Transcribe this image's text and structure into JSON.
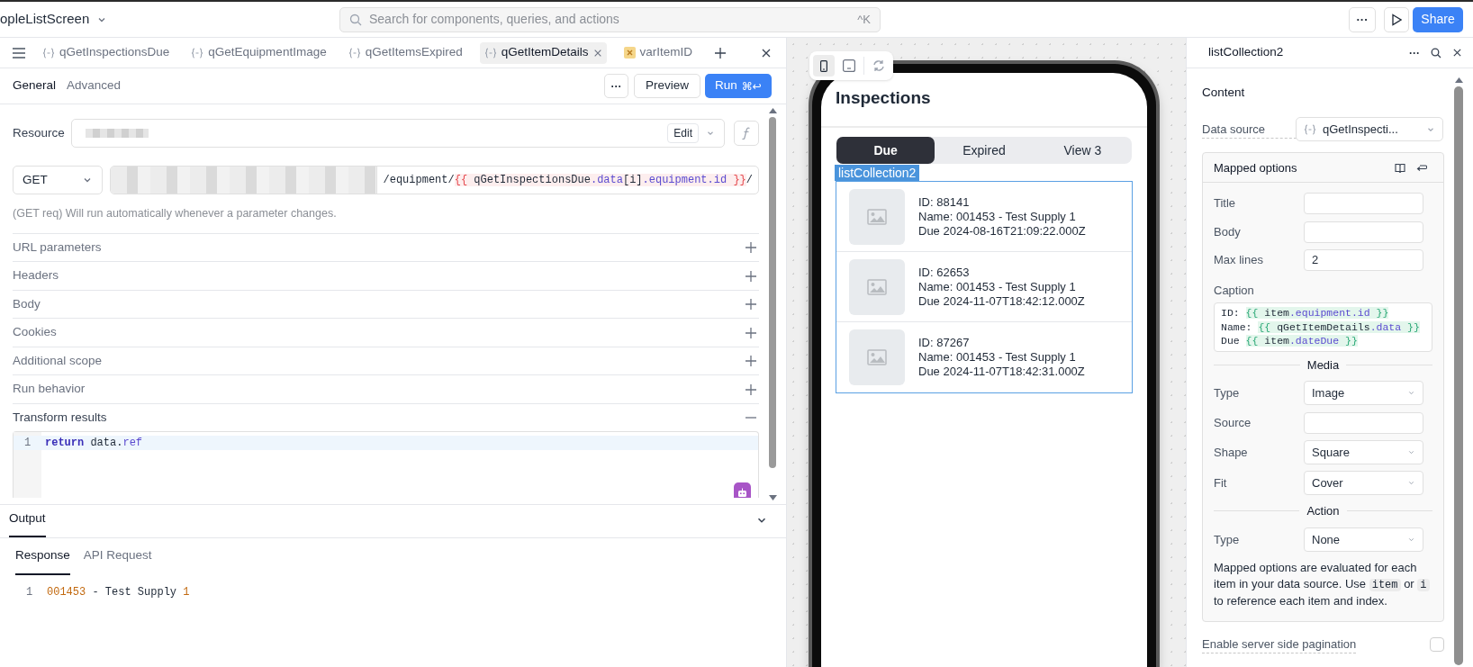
{
  "top_bar": {
    "screen_name": "opleListScreen",
    "search": {
      "placeholder": "Search for components, queries, and actions",
      "shortcut": "^K"
    },
    "more_button": "···",
    "share_button": "Share"
  },
  "query_tabs": [
    {
      "label": "qGetInspectionsDue",
      "kind": "query",
      "selected": false
    },
    {
      "label": "qGetEquipmentImage",
      "kind": "query",
      "selected": false
    },
    {
      "label": "qGetItemsExpired",
      "kind": "query",
      "selected": false
    },
    {
      "label": "qGetItemDetails",
      "kind": "query",
      "selected": true
    },
    {
      "label": "varItemID",
      "kind": "variable",
      "selected": false
    }
  ],
  "editor_tabs": [
    {
      "label": "General",
      "selected": true
    },
    {
      "label": "Advanced",
      "selected": false
    }
  ],
  "toolbar": {
    "more_button": "···",
    "preview_button": "Preview",
    "run_button": {
      "label": "Run",
      "shortcut": "⌘↩"
    }
  },
  "resource": {
    "label": "Resource",
    "edit_button": "Edit"
  },
  "request": {
    "method": "GET",
    "url_segments": [
      {
        "text": "/equipment/",
        "kind": "text"
      },
      {
        "text": "{{",
        "kind": "brace"
      },
      {
        "text": " qGetInspectionsDue",
        "kind": "ident"
      },
      {
        "text": ".data",
        "kind": "prop"
      },
      {
        "text": "[i]",
        "kind": "ident"
      },
      {
        "text": ".equipment.id",
        "kind": "prop"
      },
      {
        "text": " }}",
        "kind": "brace"
      },
      {
        "text": "/",
        "kind": "text"
      }
    ]
  },
  "hint": "(GET req) Will run automatically whenever a parameter changes.",
  "sections": [
    {
      "label": "URL parameters",
      "expanded": false
    },
    {
      "label": "Headers",
      "expanded": false
    },
    {
      "label": "Body",
      "expanded": false
    },
    {
      "label": "Cookies",
      "expanded": false
    },
    {
      "label": "Additional scope",
      "expanded": false
    },
    {
      "label": "Run behavior",
      "expanded": false
    },
    {
      "label": "Transform results",
      "expanded": true
    }
  ],
  "transform_code": [
    {
      "line": "1",
      "segments": [
        {
          "text": "return",
          "kind": "keyword"
        },
        {
          "text": " data.",
          "kind": "ident"
        },
        {
          "text": "ref",
          "kind": "prop"
        }
      ]
    }
  ],
  "output": {
    "title": "Output",
    "tabs": [
      {
        "label": "Response",
        "selected": true
      },
      {
        "label": "API Request",
        "selected": false
      }
    ],
    "lines": [
      {
        "line": "1",
        "segments": [
          {
            "text": "001453",
            "kind": "number"
          },
          {
            "text": " - Test Supply ",
            "kind": "ident"
          },
          {
            "text": "1",
            "kind": "number"
          }
        ]
      }
    ]
  },
  "canvas": {
    "app_title": "Inspections",
    "view_tabs": [
      {
        "label": "Due",
        "selected": true
      },
      {
        "label": "Expired",
        "selected": false
      },
      {
        "label": "View 3",
        "selected": false
      }
    ],
    "component_label": "listCollection2",
    "items": [
      {
        "lines": [
          "ID: 88141",
          "Name: 001453 - Test Supply 1",
          "Due 2024-08-16T21:09:22.000Z"
        ]
      },
      {
        "lines": [
          "ID: 62653",
          "Name: 001453 - Test Supply 1",
          "Due 2024-11-07T18:42:12.000Z"
        ]
      },
      {
        "lines": [
          "ID: 87267",
          "Name: 001453 - Test Supply 1",
          "Due 2024-11-07T18:42:31.000Z"
        ]
      }
    ]
  },
  "inspector": {
    "title": "listCollection2",
    "more_button": "···",
    "section": "Content",
    "data_source": {
      "label": "Data source",
      "value": "qGetInspecti..."
    },
    "mapped_options": {
      "title": "Mapped options",
      "rows": [
        {
          "kind": "input",
          "label": "Title"
        },
        {
          "kind": "input",
          "label": "Body"
        },
        {
          "kind": "input",
          "label": "Max lines",
          "value": "2"
        },
        {
          "kind": "code",
          "label": "Caption",
          "lines": [
            [
              {
                "text": "ID: ",
                "kind": "text"
              },
              {
                "text": "{{",
                "kind": "brace"
              },
              {
                "text": " item",
                "kind": "ident"
              },
              {
                "text": ".equipment.id",
                "kind": "prop"
              },
              {
                "text": " }}",
                "kind": "brace"
              }
            ],
            [
              {
                "text": "Name: ",
                "kind": "text"
              },
              {
                "text": "{{",
                "kind": "brace"
              },
              {
                "text": " qGetItemDetails",
                "kind": "ident"
              },
              {
                "text": ".data",
                "kind": "prop"
              },
              {
                "text": " }}",
                "kind": "brace"
              }
            ],
            [
              {
                "text": "Due ",
                "kind": "text"
              },
              {
                "text": "{{",
                "kind": "brace"
              },
              {
                "text": " item",
                "kind": "ident"
              },
              {
                "text": ".dateDue",
                "kind": "prop"
              },
              {
                "text": " }}",
                "kind": "brace"
              }
            ]
          ]
        },
        {
          "kind": "divider",
          "label": "Media"
        },
        {
          "kind": "select",
          "label": "Type",
          "value": "Image"
        },
        {
          "kind": "input",
          "label": "Source"
        },
        {
          "kind": "select",
          "label": "Shape",
          "value": "Square"
        },
        {
          "kind": "select",
          "label": "Fit",
          "value": "Cover"
        },
        {
          "kind": "divider",
          "label": "Action"
        },
        {
          "kind": "select",
          "label": "Type",
          "value": "None"
        }
      ],
      "note": [
        {
          "text": "Mapped options are evaluated for each item in your data source. Use ",
          "kind": "text"
        },
        {
          "text": "item",
          "kind": "code"
        },
        {
          "text": " or ",
          "kind": "text"
        },
        {
          "text": "i",
          "kind": "code"
        },
        {
          "text": " to reference each item and index.",
          "kind": "text"
        }
      ]
    },
    "pagination": {
      "label": "Enable server side pagination",
      "checked": false
    }
  }
}
